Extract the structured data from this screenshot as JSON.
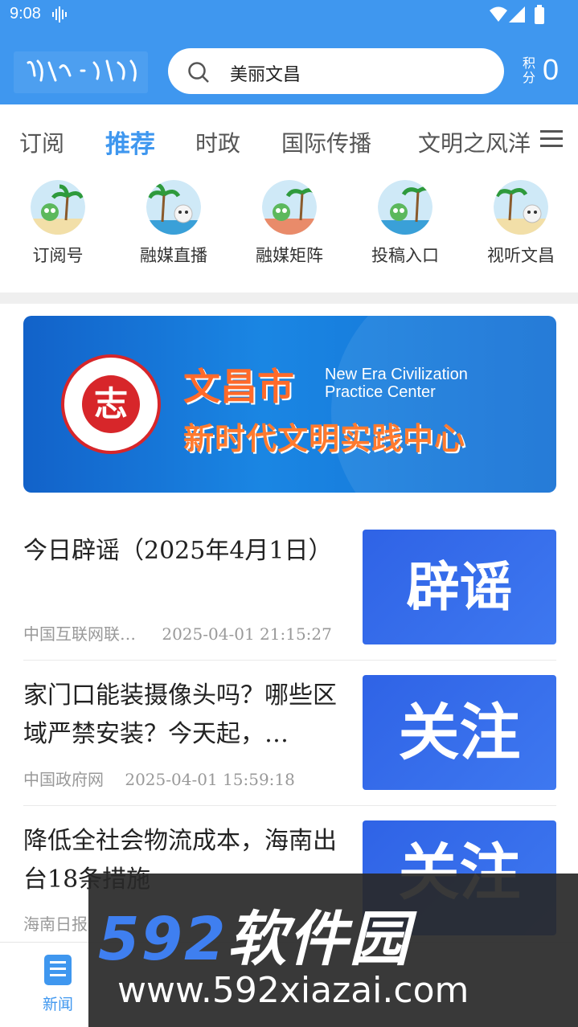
{
  "status_bar": {
    "time": "9:08"
  },
  "header": {
    "search_text": "美丽文昌",
    "points_label": "积分",
    "points_value": "0"
  },
  "tabs": [
    {
      "label": "订阅",
      "active": false
    },
    {
      "label": "推荐",
      "active": true
    },
    {
      "label": "时政",
      "active": false
    },
    {
      "label": "国际传播",
      "active": false
    },
    {
      "label": "文明之风洋",
      "active": false
    }
  ],
  "quick_links": [
    {
      "label": "订阅号",
      "icon": "mascot-icon"
    },
    {
      "label": "融媒直播",
      "icon": "mascot-icon"
    },
    {
      "label": "融媒矩阵",
      "icon": "mascot-icon"
    },
    {
      "label": "投稿入口",
      "icon": "mascot-icon"
    },
    {
      "label": "视听文昌",
      "icon": "mascot-icon"
    }
  ],
  "banner": {
    "city": "文昌市",
    "english_line1": "New Era Civilization",
    "english_line2": "Practice Center",
    "chinese_subtitle": "新时代文明实践中心",
    "emblem_char": "志"
  },
  "news": [
    {
      "title": "今日辟谣（2025年4月1日）",
      "source": "中国互联网联…",
      "time": "2025-04-01 21:15:27",
      "thumb_text": "辟谣"
    },
    {
      "title": "家门口能装摄像头吗？哪些区域严禁安装？今天起，…",
      "source": "中国政府网",
      "time": "2025-04-01 15:59:18",
      "thumb_text": "关注"
    },
    {
      "title": "降低全社会物流成本，海南出台18条措施",
      "source": "海南日报",
      "time": "",
      "thumb_text": "关注"
    }
  ],
  "bottom_nav": {
    "news_label": "新闻"
  },
  "watermark": {
    "brand_num": "592",
    "brand_text": "软件园",
    "url": "www.592xiazai.com"
  },
  "colors": {
    "primary": "#3f97ef",
    "thumb_blue": "#2f63e6",
    "banner_orange": "#ff6a2a"
  }
}
